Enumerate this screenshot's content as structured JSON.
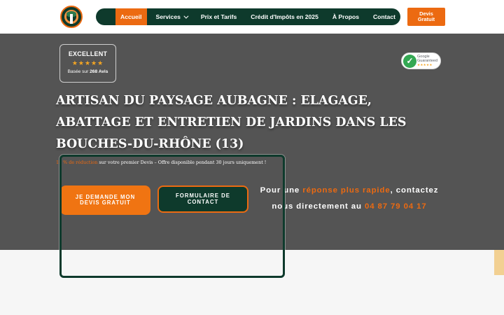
{
  "header": {
    "logo_name": "logo-tree-icon",
    "nav": {
      "items": [
        {
          "label": "Accueil",
          "active": true
        },
        {
          "label": "Services",
          "has_dropdown": true
        },
        {
          "label": "Prix et Tarifs"
        },
        {
          "label": "Crédit d'Impôts en 2025"
        },
        {
          "label": "À Propos"
        },
        {
          "label": "Contact"
        }
      ]
    },
    "devis_button": "Devis Gratuit"
  },
  "rating": {
    "title": "EXCELLENT",
    "stars": "★★★★★",
    "base_prefix": "Basée sur ",
    "base_count": "268 Avis"
  },
  "google_badge": {
    "line1": "Google",
    "line2": "Guaranteed",
    "stars": "★★★★★"
  },
  "hero": {
    "title": "ARTISAN DU PAYSAGE AUBAGNE : ELAGAGE, ABATTAGE ET ENTRETIEN DE JARDINS DANS LES BOUCHES-DU-RHÔNE (13)",
    "promo_highlight": "15 % de réduction",
    "promo_text": " sur votre premier Devis – Offre disponible pendant 30 jours uniquement !",
    "cta_primary": "JE DEMANDE MON DEVIS GRATUIT",
    "cta_secondary": "FORMULAIRE DE CONTACT",
    "contact": {
      "pre": "Pour une ",
      "highlight": "réponse plus rapide",
      "mid": ", contactez",
      "line2_pre": "nous directement au ",
      "phone": "04 87 79 04 17"
    }
  },
  "colors": {
    "brand_green": "#0e3a2c",
    "brand_orange": "#ec6a11",
    "hero_bg": "#545454"
  }
}
